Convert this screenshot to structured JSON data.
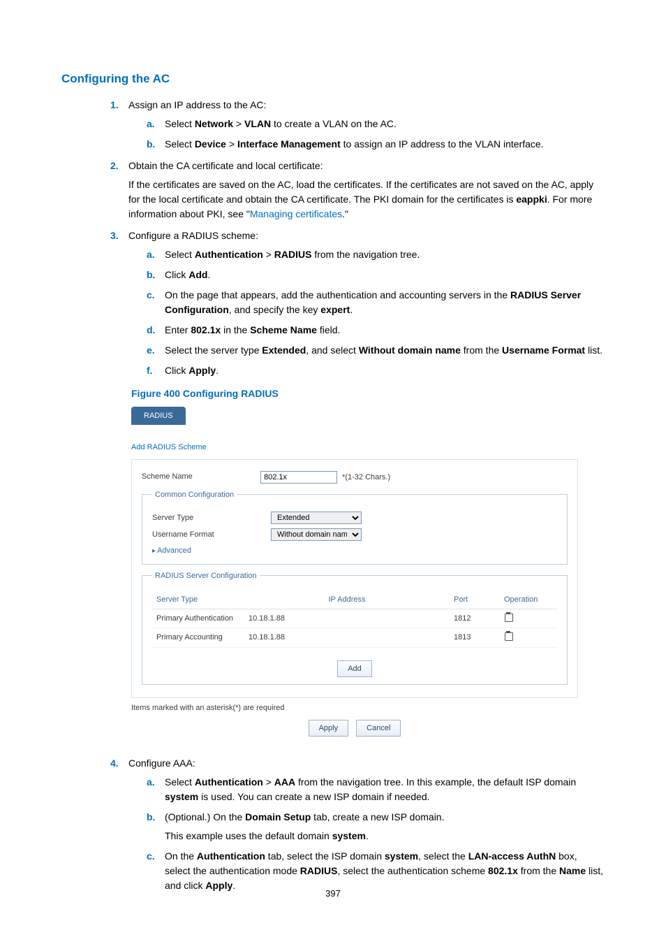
{
  "heading": "Configuring the AC",
  "steps": {
    "s1": {
      "title": "Assign an IP address to the AC:",
      "a_pre": "Select ",
      "a_net": "Network",
      "a_gt": " > ",
      "a_vlan": "VLAN",
      "a_post": " to create a VLAN on the AC.",
      "b_pre": "Select ",
      "b_dev": "Device",
      "b_gt": " > ",
      "b_if": "Interface Management",
      "b_post": " to assign an IP address to the VLAN interface."
    },
    "s2": {
      "title": "Obtain the CA certificate and local certificate:",
      "p_pre": "If the certificates are saved on the AC, load the certificates. If the certificates are not saved on the AC, apply for the local certificate and obtain the CA certificate. The PKI domain for the certificates is ",
      "p_dom": "eappki",
      "p_mid": ". For more information about PKI, see \"",
      "p_link": "Managing certificates",
      "p_after": ".\""
    },
    "s3": {
      "title": "Configure a RADIUS scheme:",
      "a_pre": "Select ",
      "a_auth": "Authentication",
      "a_gt": " > ",
      "a_rad": "RADIUS",
      "a_post": " from the navigation tree.",
      "b_pre": "Click ",
      "b_add": "Add",
      "b_post": ".",
      "c_pre": "On the page that appears, add the authentication and accounting servers in the ",
      "c_rsc": "RADIUS Server Configuration",
      "c_mid": ", and specify the key ",
      "c_key": "expert",
      "c_post": ".",
      "d_pre": "Enter ",
      "d_val": "802.1x",
      "d_mid": " in the ",
      "d_field": "Scheme Name",
      "d_post": " field.",
      "e_pre": "Select the server type ",
      "e_ext": "Extended",
      "e_mid": ", and select ",
      "e_wdn": "Without domain name",
      "e_mid2": " from the ",
      "e_uf": "Username Format",
      "e_post": " list.",
      "f_pre": "Click ",
      "f_apply": "Apply",
      "f_post": "."
    },
    "s4": {
      "title": "Configure AAA:",
      "a_pre": "Select ",
      "a_auth": "Authentication",
      "a_gt": " > ",
      "a_aaa": "AAA",
      "a_mid": " from the navigation tree. In this example, the default ISP domain ",
      "a_sys": "system",
      "a_post": " is used. You can create a new ISP domain if needed.",
      "b_pre": "(Optional.) On the ",
      "b_ds": "Domain Setup",
      "b_post": " tab, create a new ISP domain.",
      "b_para": "This example uses the default domain ",
      "b_sys": "system",
      "b_dot": ".",
      "c_pre": "On the ",
      "c_auth": "Authentication",
      "c_mid1": " tab, select the ISP domain ",
      "c_sys": "system",
      "c_mid2": ", select the ",
      "c_lan": "LAN-access AuthN",
      "c_mid3": " box, select the authentication mode ",
      "c_rad": "RADIUS",
      "c_mid4": ", select the authentication scheme ",
      "c_sch": "802.1x",
      "c_mid5": " from the ",
      "c_name": "Name",
      "c_mid6": " list, and click ",
      "c_apply": "Apply",
      "c_post": "."
    }
  },
  "figcap": "Figure 400 Configuring RADIUS",
  "shot": {
    "tab": "RADIUS",
    "add_title": "Add RADIUS Scheme",
    "scheme_label": "Scheme Name",
    "scheme_value": "802.1x",
    "scheme_hint": "*(1-32 Chars.)",
    "common_legend": "Common Configuration",
    "server_type_label": "Server Type",
    "server_type_value": "Extended",
    "username_format_label": "Username Format",
    "username_format_value": "Without domain name",
    "advanced": "Advanced",
    "rsc_legend": "RADIUS Server Configuration",
    "th_type": "Server Type",
    "th_ip": "IP Address",
    "th_port": "Port",
    "th_op": "Operation",
    "rows": [
      {
        "type": "Primary Authentication",
        "ip": "10.18.1.88",
        "port": "1812"
      },
      {
        "type": "Primary Accounting",
        "ip": "10.18.1.88",
        "port": "1813"
      }
    ],
    "add_btn": "Add",
    "note": "Items marked with an asterisk(*) are required",
    "apply_btn": "Apply",
    "cancel_btn": "Cancel"
  },
  "pagenum": "397"
}
